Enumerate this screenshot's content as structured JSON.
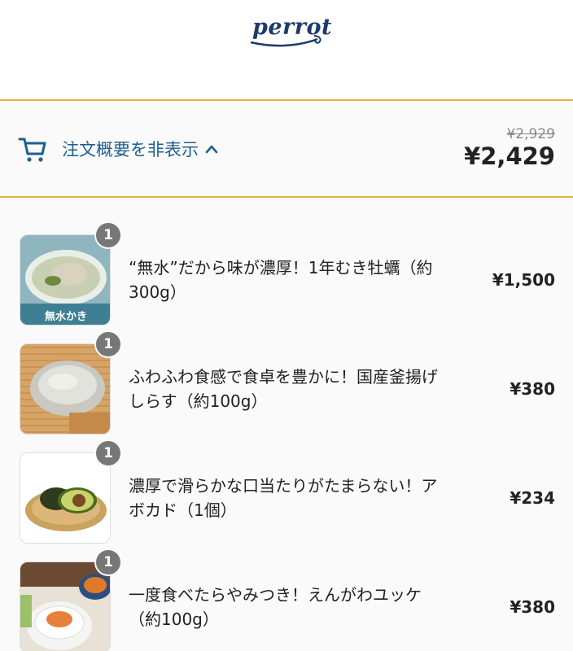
{
  "brand": {
    "logo_text": "perrot"
  },
  "summary": {
    "toggle_label": "注文概要を非表示",
    "icon": "cart-icon",
    "original_total": "¥2,929",
    "total": "¥2,429"
  },
  "items": [
    {
      "quantity": "1",
      "name": "“無水”だから味が濃厚！1年むき牡蠣（約300g）",
      "price": "¥1,500",
      "image_caption": "無水かき"
    },
    {
      "quantity": "1",
      "name": "ふわふわ食感で食卓を豊かに！国産釜揚げしらす（約100g）",
      "price": "¥380"
    },
    {
      "quantity": "1",
      "name": "濃厚で滑らかな口当たりがたまらない！アボカド（1個）",
      "price": "¥234"
    },
    {
      "quantity": "1",
      "name": "一度食べたらやみつき！えんがわユッケ（約100g）",
      "price": "¥380"
    }
  ],
  "colors": {
    "accent_border": "#e0b444",
    "link": "#1f5f8f",
    "brand": "#1d3a6b"
  }
}
